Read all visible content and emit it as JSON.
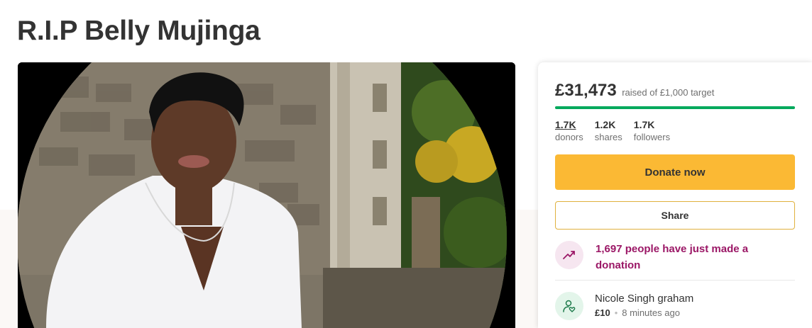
{
  "page": {
    "title": "R.I.P Belly Mujinga",
    "colors": {
      "accent_green": "#02a95c",
      "donate_yellow": "#fbb934",
      "trend_purple": "#9b1766"
    }
  },
  "photo": {
    "icon": "fundraiser-photo"
  },
  "fundraiser": {
    "amount": "£31,473",
    "amount_caption": "raised of £1,000 target",
    "progress_percent": 100,
    "stats": [
      {
        "value": "1.7K",
        "label": "donors"
      },
      {
        "value": "1.2K",
        "label": "shares"
      },
      {
        "value": "1.7K",
        "label": "followers"
      }
    ],
    "donate_label": "Donate now",
    "share_label": "Share",
    "trend_icon": "trending-up-icon",
    "trend_text": "1,697 people have just made a donation",
    "recent_donation": {
      "icon": "donor-heart-icon",
      "name": "Nicole Singh graham",
      "amount": "£10",
      "time": "8 minutes ago"
    }
  }
}
